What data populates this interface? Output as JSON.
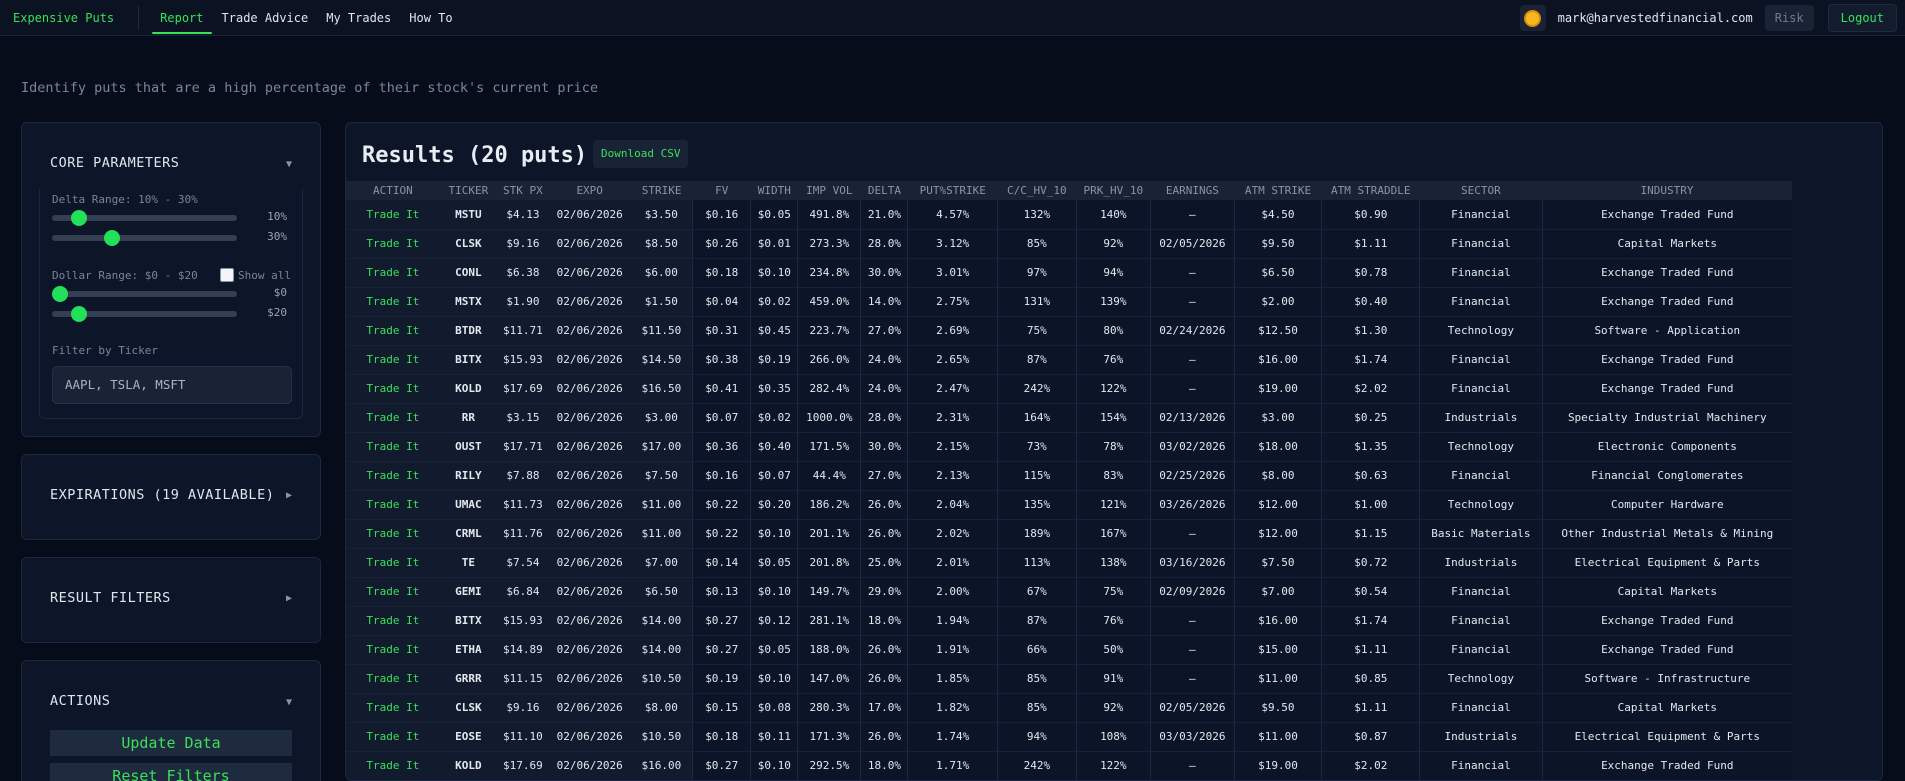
{
  "nav": {
    "brand": "Expensive Puts",
    "links": [
      "Report",
      "Trade Advice",
      "My Trades",
      "How To"
    ],
    "user_email": "mark@harvestedfinancial.com",
    "risk": "Risk",
    "logout": "Logout"
  },
  "subtitle": "Identify puts that are a high percentage of their stock's current price",
  "core": {
    "title": "CORE PARAMETERS",
    "delta_label": "Delta Range: 10% - 30%",
    "delta_min": "10%",
    "delta_max": "30%",
    "dollar_label": "Dollar Range: $0 - $20",
    "show_all": "Show all",
    "dollar_min": "$0",
    "dollar_max": "$20",
    "filter_label": "Filter by Ticker",
    "filter_placeholder": "AAPL, TSLA, MSFT"
  },
  "expirations": {
    "title": "EXPIRATIONS (19 AVAILABLE)"
  },
  "result_filters": {
    "title": "RESULT FILTERS"
  },
  "actions": {
    "title": "ACTIONS",
    "update": "Update Data",
    "reset": "Reset Filters"
  },
  "results": {
    "title": "Results (20 puts)",
    "download": "Download CSV",
    "columns": [
      "ACTION",
      "TICKER",
      "STK PX",
      "EXPO",
      "STRIKE",
      "FV",
      "WIDTH",
      "IMP VOL",
      "DELTA",
      "PUT%STRIKE",
      "C/C_HV_10",
      "PRK_HV_10",
      "EARNINGS",
      "ATM STRIKE",
      "ATM STRADDLE",
      "SECTOR",
      "INDUSTRY"
    ],
    "rows": [
      [
        "Trade It",
        "MSTU",
        "$4.13",
        "02/06/2026",
        "$3.50",
        "$0.16",
        "$0.05",
        "491.8%",
        "21.0%",
        "4.57%",
        "132%",
        "140%",
        "—",
        "$4.50",
        "$0.90",
        "Financial",
        "Exchange Traded Fund"
      ],
      [
        "Trade It",
        "CLSK",
        "$9.16",
        "02/06/2026",
        "$8.50",
        "$0.26",
        "$0.01",
        "273.3%",
        "28.0%",
        "3.12%",
        "85%",
        "92%",
        "02/05/2026",
        "$9.50",
        "$1.11",
        "Financial",
        "Capital Markets"
      ],
      [
        "Trade It",
        "CONL",
        "$6.38",
        "02/06/2026",
        "$6.00",
        "$0.18",
        "$0.10",
        "234.8%",
        "30.0%",
        "3.01%",
        "97%",
        "94%",
        "—",
        "$6.50",
        "$0.78",
        "Financial",
        "Exchange Traded Fund"
      ],
      [
        "Trade It",
        "MSTX",
        "$1.90",
        "02/06/2026",
        "$1.50",
        "$0.04",
        "$0.02",
        "459.0%",
        "14.0%",
        "2.75%",
        "131%",
        "139%",
        "—",
        "$2.00",
        "$0.40",
        "Financial",
        "Exchange Traded Fund"
      ],
      [
        "Trade It",
        "BTDR",
        "$11.71",
        "02/06/2026",
        "$11.50",
        "$0.31",
        "$0.45",
        "223.7%",
        "27.0%",
        "2.69%",
        "75%",
        "80%",
        "02/24/2026",
        "$12.50",
        "$1.30",
        "Technology",
        "Software - Application"
      ],
      [
        "Trade It",
        "BITX",
        "$15.93",
        "02/06/2026",
        "$14.50",
        "$0.38",
        "$0.19",
        "266.0%",
        "24.0%",
        "2.65%",
        "87%",
        "76%",
        "—",
        "$16.00",
        "$1.74",
        "Financial",
        "Exchange Traded Fund"
      ],
      [
        "Trade It",
        "KOLD",
        "$17.69",
        "02/06/2026",
        "$16.50",
        "$0.41",
        "$0.35",
        "282.4%",
        "24.0%",
        "2.47%",
        "242%",
        "122%",
        "—",
        "$19.00",
        "$2.02",
        "Financial",
        "Exchange Traded Fund"
      ],
      [
        "Trade It",
        "RR",
        "$3.15",
        "02/06/2026",
        "$3.00",
        "$0.07",
        "$0.02",
        "1000.0%",
        "28.0%",
        "2.31%",
        "164%",
        "154%",
        "02/13/2026",
        "$3.00",
        "$0.25",
        "Industrials",
        "Specialty Industrial Machinery"
      ],
      [
        "Trade It",
        "OUST",
        "$17.71",
        "02/06/2026",
        "$17.00",
        "$0.36",
        "$0.40",
        "171.5%",
        "30.0%",
        "2.15%",
        "73%",
        "78%",
        "03/02/2026",
        "$18.00",
        "$1.35",
        "Technology",
        "Electronic Components"
      ],
      [
        "Trade It",
        "RILY",
        "$7.88",
        "02/06/2026",
        "$7.50",
        "$0.16",
        "$0.07",
        "44.4%",
        "27.0%",
        "2.13%",
        "115%",
        "83%",
        "02/25/2026",
        "$8.00",
        "$0.63",
        "Financial",
        "Financial Conglomerates"
      ],
      [
        "Trade It",
        "UMAC",
        "$11.73",
        "02/06/2026",
        "$11.00",
        "$0.22",
        "$0.20",
        "186.2%",
        "26.0%",
        "2.04%",
        "135%",
        "121%",
        "03/26/2026",
        "$12.00",
        "$1.00",
        "Technology",
        "Computer Hardware"
      ],
      [
        "Trade It",
        "CRML",
        "$11.76",
        "02/06/2026",
        "$11.00",
        "$0.22",
        "$0.10",
        "201.1%",
        "26.0%",
        "2.02%",
        "189%",
        "167%",
        "—",
        "$12.00",
        "$1.15",
        "Basic Materials",
        "Other Industrial Metals & Mining"
      ],
      [
        "Trade It",
        "TE",
        "$7.54",
        "02/06/2026",
        "$7.00",
        "$0.14",
        "$0.05",
        "201.8%",
        "25.0%",
        "2.01%",
        "113%",
        "138%",
        "03/16/2026",
        "$7.50",
        "$0.72",
        "Industrials",
        "Electrical Equipment & Parts"
      ],
      [
        "Trade It",
        "GEMI",
        "$6.84",
        "02/06/2026",
        "$6.50",
        "$0.13",
        "$0.10",
        "149.7%",
        "29.0%",
        "2.00%",
        "67%",
        "75%",
        "02/09/2026",
        "$7.00",
        "$0.54",
        "Financial",
        "Capital Markets"
      ],
      [
        "Trade It",
        "BITX",
        "$15.93",
        "02/06/2026",
        "$14.00",
        "$0.27",
        "$0.12",
        "281.1%",
        "18.0%",
        "1.94%",
        "87%",
        "76%",
        "—",
        "$16.00",
        "$1.74",
        "Financial",
        "Exchange Traded Fund"
      ],
      [
        "Trade It",
        "ETHA",
        "$14.89",
        "02/06/2026",
        "$14.00",
        "$0.27",
        "$0.05",
        "188.0%",
        "26.0%",
        "1.91%",
        "66%",
        "50%",
        "—",
        "$15.00",
        "$1.11",
        "Financial",
        "Exchange Traded Fund"
      ],
      [
        "Trade It",
        "GRRR",
        "$11.15",
        "02/06/2026",
        "$10.50",
        "$0.19",
        "$0.10",
        "147.0%",
        "26.0%",
        "1.85%",
        "85%",
        "91%",
        "—",
        "$11.00",
        "$0.85",
        "Technology",
        "Software - Infrastructure"
      ],
      [
        "Trade It",
        "CLSK",
        "$9.16",
        "02/06/2026",
        "$8.00",
        "$0.15",
        "$0.08",
        "280.3%",
        "17.0%",
        "1.82%",
        "85%",
        "92%",
        "02/05/2026",
        "$9.50",
        "$1.11",
        "Financial",
        "Capital Markets"
      ],
      [
        "Trade It",
        "EOSE",
        "$11.10",
        "02/06/2026",
        "$10.50",
        "$0.18",
        "$0.11",
        "171.3%",
        "26.0%",
        "1.74%",
        "94%",
        "108%",
        "03/03/2026",
        "$11.00",
        "$0.87",
        "Industrials",
        "Electrical Equipment & Parts"
      ],
      [
        "Trade It",
        "KOLD",
        "$17.69",
        "02/06/2026",
        "$16.00",
        "$0.27",
        "$0.10",
        "292.5%",
        "18.0%",
        "1.71%",
        "242%",
        "122%",
        "—",
        "$19.00",
        "$2.02",
        "Financial",
        "Exchange Traded Fund"
      ]
    ]
  }
}
